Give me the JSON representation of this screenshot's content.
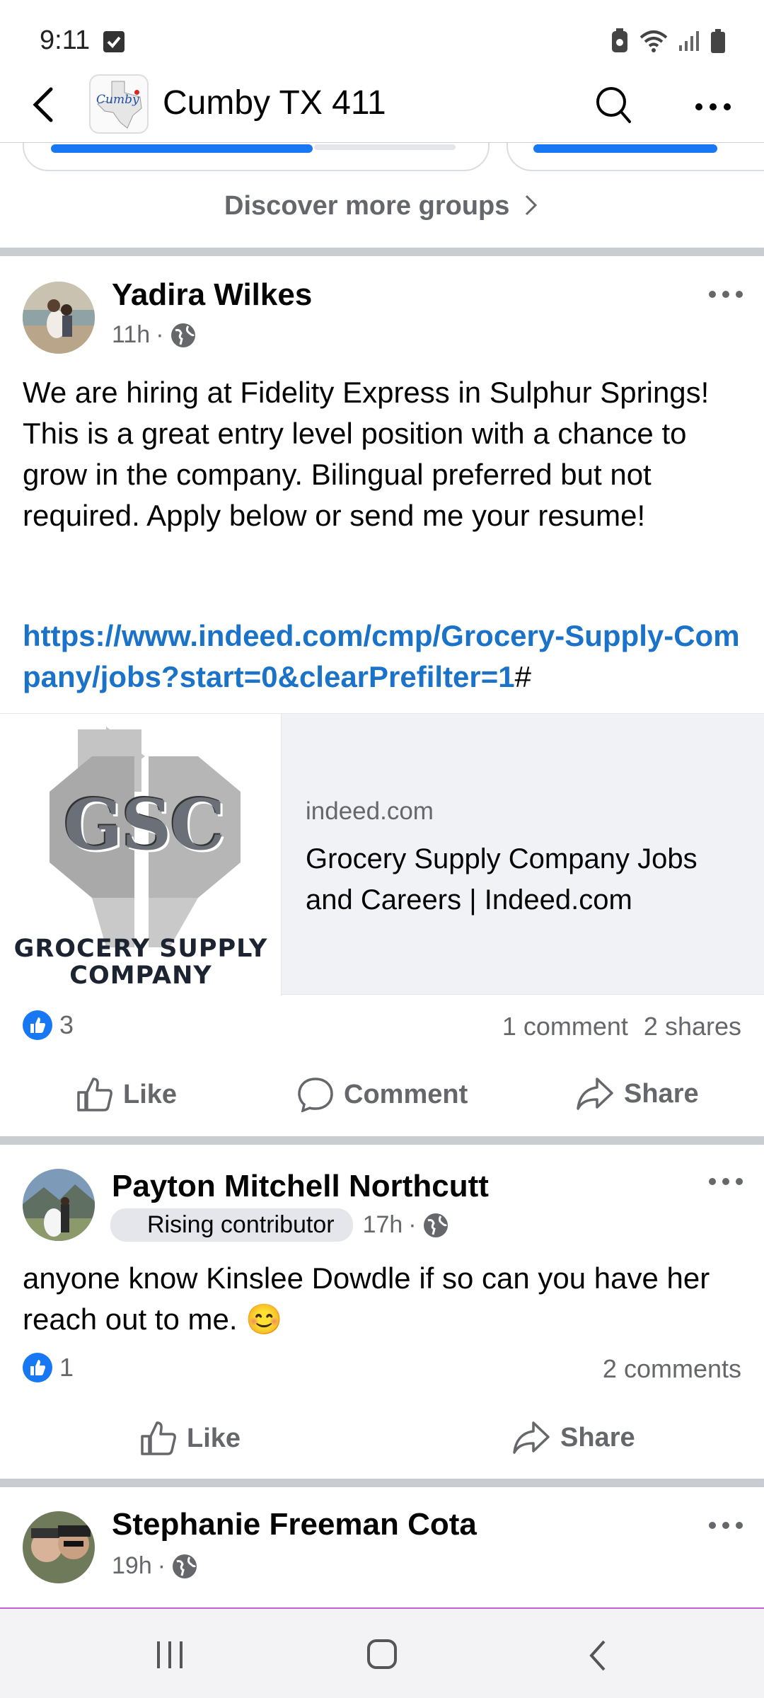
{
  "status": {
    "time": "9:11"
  },
  "header": {
    "group_name": "Cumby TX 411",
    "avatar_label": "Cumby"
  },
  "discover": {
    "label": "Discover more groups"
  },
  "post1": {
    "author": "Yadira Wilkes",
    "time": "11h",
    "text": "We are hiring at Fidelity Express in Sulphur Springs! This is a great entry level position with a chance to grow in the company. Bilingual preferred but not required. Apply below or send me your resume!",
    "link": "https://www.indeed.com/cmp/Grocery-Supply-Company/jobs?start=0&clearPrefilter=1",
    "link_suffix": "#",
    "preview": {
      "image_text": "GSC",
      "image_caption_1": "GROCERY SUPPLY",
      "image_caption_2": "COMPANY",
      "domain": "indeed.com",
      "title": "Grocery Supply Company Jobs and Careers | Indeed.com"
    },
    "likes": "3",
    "comments": "1 comment",
    "shares": "2 shares",
    "actions": {
      "like": "Like",
      "comment": "Comment",
      "share": "Share"
    }
  },
  "post2": {
    "author": "Payton Mitchell Northcutt",
    "badge": "Rising contributor",
    "time": "17h",
    "text": "anyone know Kinslee Dowdle if so can you have her reach out to me. 😊",
    "likes": "1",
    "comments": "2 comments",
    "actions": {
      "like": "Like",
      "share": "Share"
    }
  },
  "post3": {
    "author": "Stephanie Freeman Cota",
    "time": "19h"
  },
  "colors": {
    "link": "#1a73c8",
    "like_blue": "#1877f2",
    "secondary": "#65676b"
  }
}
